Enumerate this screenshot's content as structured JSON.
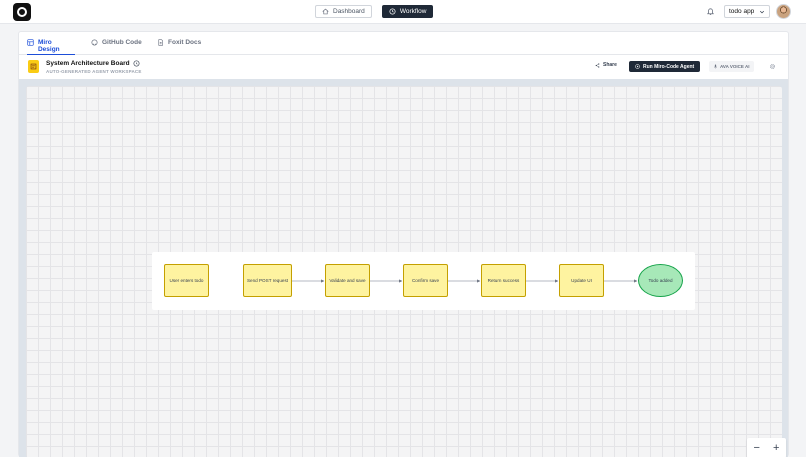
{
  "header": {
    "nav": [
      {
        "label": "Dashboard",
        "icon": "home-icon",
        "active": false
      },
      {
        "label": "Workflow",
        "icon": "workflow-icon",
        "active": true
      }
    ],
    "app_select": "todo app"
  },
  "tabs": [
    {
      "label": "Miro Design",
      "icon": "board-icon"
    },
    {
      "label": "GitHub Code",
      "icon": "github-icon"
    },
    {
      "label": "Foxit Docs",
      "icon": "document-icon"
    }
  ],
  "board": {
    "title": "System Architecture Board",
    "subtitle": "AUTO-GENERATED AGENT WORKSPACE",
    "share_label": "Share",
    "run_label": "Run Miro-Code Agent",
    "voice_label": "AVA VOICE AI"
  },
  "flow": {
    "nodes": [
      {
        "label": "User enters todo"
      },
      {
        "label": "Send POST request"
      },
      {
        "label": "Validate and save"
      },
      {
        "label": "Confirm save"
      },
      {
        "label": "Return success"
      },
      {
        "label": "Update UI"
      },
      {
        "label": "Todo added"
      }
    ]
  },
  "zoom": {
    "out": "−",
    "in": "+"
  },
  "colors": {
    "accent": "#1d4ed8",
    "dark": "#1f2937",
    "node_fill": "#fef3a0",
    "node_border": "#c4a000",
    "end_fill": "#a7e8b8",
    "end_border": "#16a34a"
  }
}
